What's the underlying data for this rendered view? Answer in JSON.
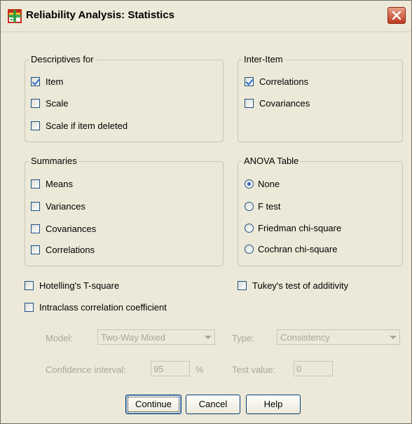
{
  "title": "Reliability Analysis: Statistics",
  "descriptives": {
    "title": "Descriptives for",
    "items": [
      {
        "label": "Item",
        "checked": true
      },
      {
        "label": "Scale",
        "checked": false
      },
      {
        "label": "Scale if item deleted",
        "checked": false
      }
    ]
  },
  "inter_item": {
    "title": "Inter-Item",
    "items": [
      {
        "label": "Correlations",
        "checked": true
      },
      {
        "label": "Covariances",
        "checked": false
      }
    ]
  },
  "summaries": {
    "title": "Summaries",
    "items": [
      {
        "label": "Means",
        "checked": false
      },
      {
        "label": "Variances",
        "checked": false
      },
      {
        "label": "Covariances",
        "checked": false
      },
      {
        "label": "Correlations",
        "checked": false
      }
    ]
  },
  "anova": {
    "title": "ANOVA Table",
    "items": [
      {
        "label": "None",
        "selected": true
      },
      {
        "label": "F test",
        "selected": false
      },
      {
        "label": "Friedman chi-square",
        "selected": false
      },
      {
        "label": "Cochran chi-square",
        "selected": false
      }
    ]
  },
  "hotelling": {
    "label": "Hotelling's T-square",
    "checked": false
  },
  "tukey": {
    "label": "Tukey's test of additivity",
    "checked": false
  },
  "icc": {
    "label": "Intraclass correlation coefficient",
    "checked": false
  },
  "model": {
    "label": "Model:",
    "value": "Two-Way Mixed"
  },
  "type": {
    "label": "Type:",
    "value": "Consistency"
  },
  "confidence": {
    "label": "Confidence interval:",
    "value": "95",
    "unit": "%"
  },
  "test_value": {
    "label": "Test value:",
    "value": "0"
  },
  "buttons": {
    "continue": "Continue",
    "cancel": "Cancel",
    "help": "Help"
  }
}
